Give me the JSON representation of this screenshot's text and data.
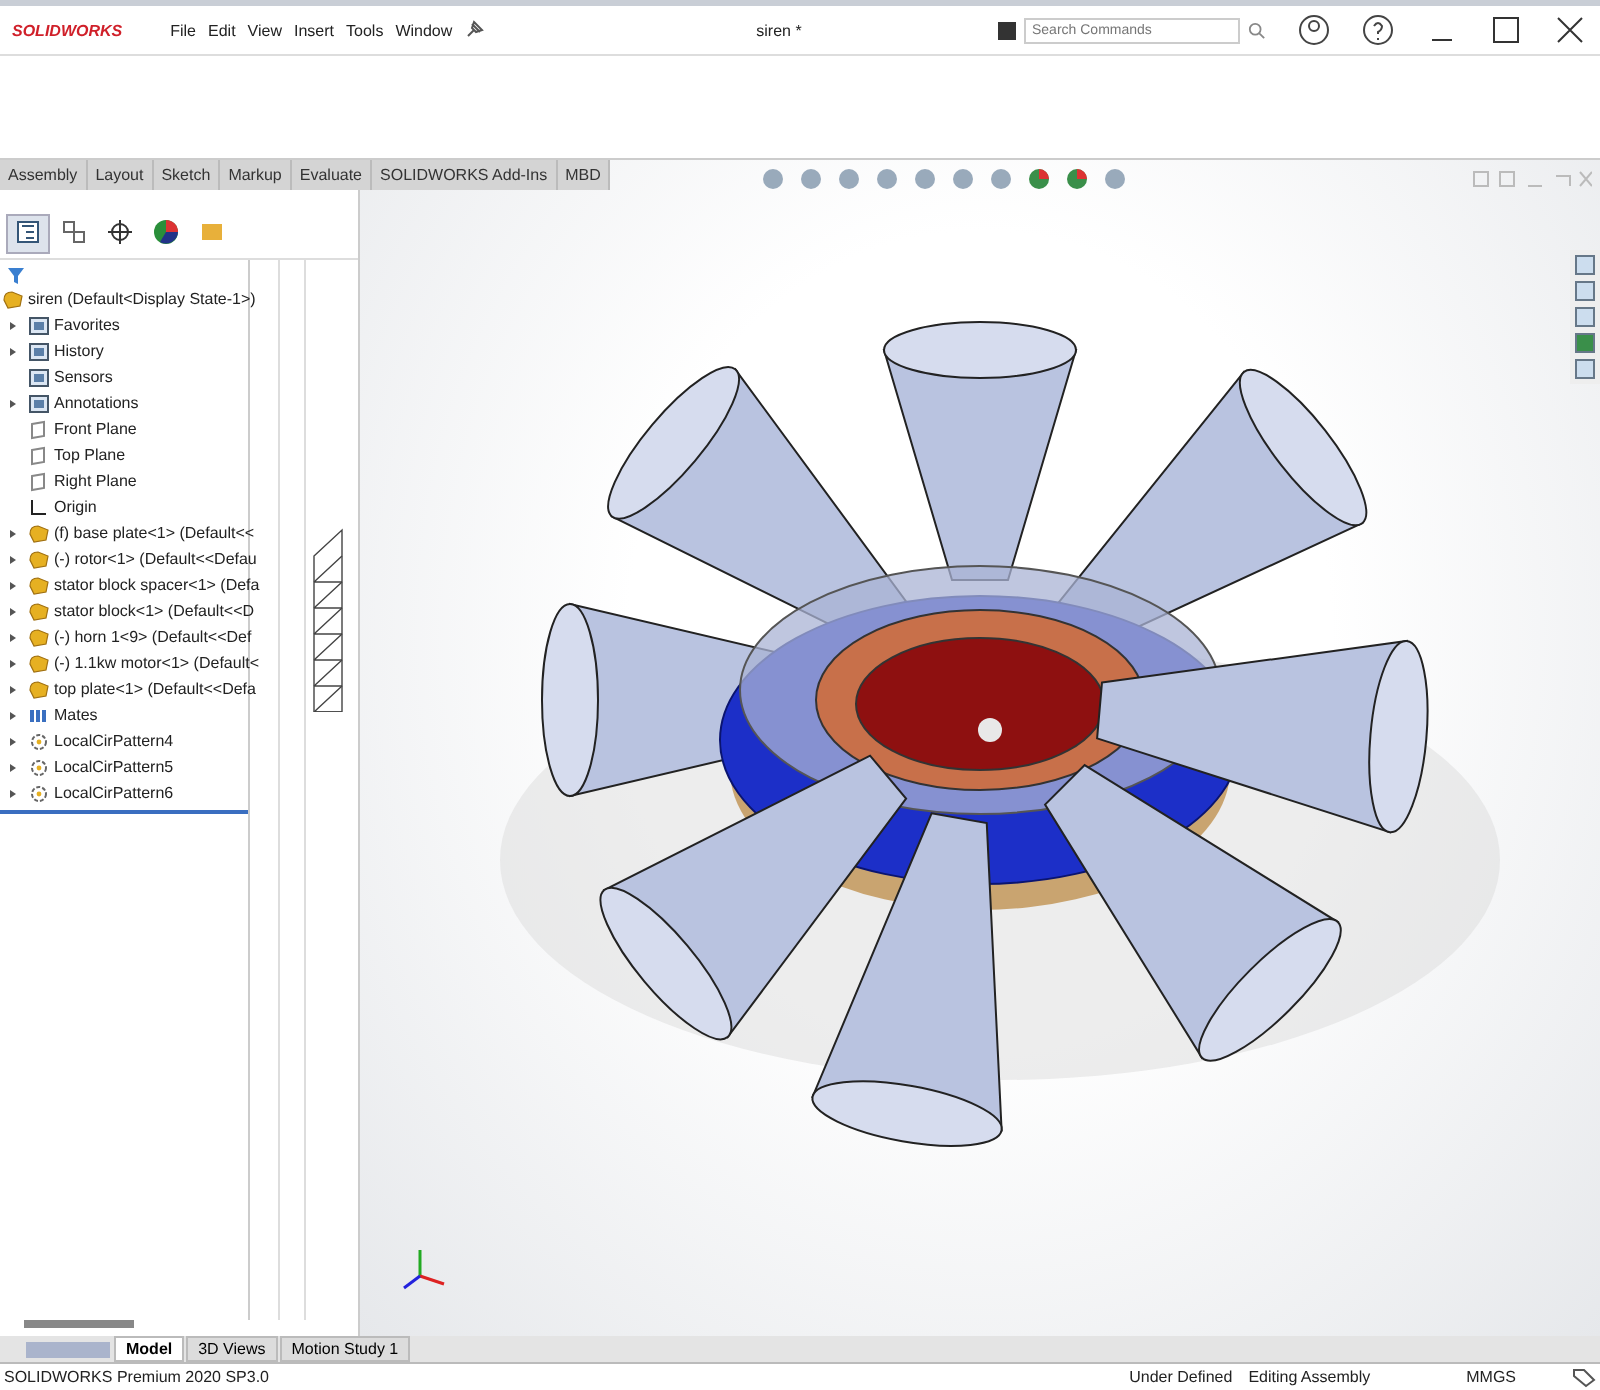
{
  "window": {
    "app_name": "SOLIDWORKS",
    "title": "siren *",
    "menu": [
      "File",
      "Edit",
      "View",
      "Insert",
      "Tools",
      "Window"
    ],
    "search": {
      "placeholder": "Search Commands"
    }
  },
  "command_tabs": [
    {
      "label": "Assembly",
      "selected": false
    },
    {
      "label": "Layout",
      "selected": false
    },
    {
      "label": "Sketch",
      "selected": false
    },
    {
      "label": "Markup",
      "selected": false
    },
    {
      "label": "Evaluate",
      "selected": false
    },
    {
      "label": "SOLIDWORKS Add-Ins",
      "selected": false
    },
    {
      "label": "MBD",
      "selected": false
    }
  ],
  "panel_tabs": [
    {
      "kind": "tree",
      "selected": true
    },
    {
      "kind": "property",
      "selected": false
    },
    {
      "kind": "config",
      "selected": false
    },
    {
      "kind": "dim",
      "selected": false
    },
    {
      "kind": "display",
      "selected": false
    }
  ],
  "tree": {
    "label": "siren  (Default<Display State-1>)",
    "children": [
      {
        "label": "Favorites",
        "kind": "folder",
        "expandable": true
      },
      {
        "label": "History",
        "kind": "folder",
        "expandable": true
      },
      {
        "label": "Sensors",
        "kind": "folder",
        "expandable": false
      },
      {
        "label": "Annotations",
        "kind": "folder",
        "expandable": true
      },
      {
        "label": "Front Plane",
        "kind": "plane",
        "expandable": false
      },
      {
        "label": "Top Plane",
        "kind": "plane",
        "expandable": false
      },
      {
        "label": "Right Plane",
        "kind": "plane",
        "expandable": false
      },
      {
        "label": "Origin",
        "kind": "origin",
        "expandable": false
      },
      {
        "label": "(f) base plate<1> (Default<<",
        "kind": "part",
        "expandable": true
      },
      {
        "label": "(-) rotor<1> (Default<<Defau",
        "kind": "part",
        "expandable": true
      },
      {
        "label": "stator block spacer<1> (Defa",
        "kind": "part",
        "expandable": true
      },
      {
        "label": "stator block<1> (Default<<D",
        "kind": "part",
        "expandable": true
      },
      {
        "label": "(-) horn 1<9> (Default<<Def",
        "kind": "part",
        "expandable": true
      },
      {
        "label": "(-) 1.1kw motor<1> (Default<",
        "kind": "part",
        "expandable": true
      },
      {
        "label": "top plate<1> (Default<<Defa",
        "kind": "part",
        "expandable": true
      },
      {
        "label": "Mates",
        "kind": "mates",
        "expandable": true
      },
      {
        "label": "LocalCirPattern4",
        "kind": "pattern",
        "expandable": true
      },
      {
        "label": "LocalCirPattern5",
        "kind": "pattern",
        "expandable": true
      },
      {
        "label": "LocalCirPattern6",
        "kind": "pattern",
        "expandable": true
      }
    ]
  },
  "bottom_tabs": [
    {
      "label": "Model",
      "selected": true
    },
    {
      "label": "3D Views",
      "selected": false
    },
    {
      "label": "Motion Study 1",
      "selected": false
    }
  ],
  "status_bar": {
    "product": "SOLIDWORKS Premium 2020 SP3.0",
    "state": "Under Defined",
    "mode": "Editing Assembly",
    "units": "MMGS"
  }
}
